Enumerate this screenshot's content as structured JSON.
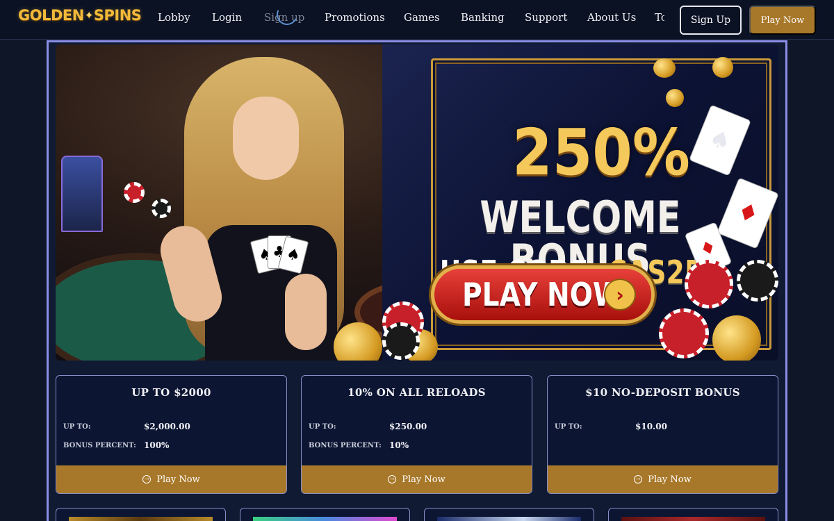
{
  "header": {
    "logo": {
      "left": "GOLDEN",
      "star": "✦",
      "right": "SPINS"
    },
    "nav": [
      {
        "label": "Lobby",
        "state": "normal"
      },
      {
        "label": "Login",
        "state": "normal"
      },
      {
        "label": "Sign up",
        "state": "loading"
      },
      {
        "label": "Promotions",
        "state": "normal"
      },
      {
        "label": "Games",
        "state": "normal"
      },
      {
        "label": "Banking",
        "state": "normal"
      },
      {
        "label": "Support",
        "state": "normal"
      },
      {
        "label": "About Us",
        "state": "normal"
      },
      {
        "label": "To",
        "state": "clipped"
      }
    ],
    "sign_up_button": "Sign Up",
    "play_now_button": "Play Now"
  },
  "hero": {
    "percent": "250%",
    "headline": "WELCOME BONUS",
    "code_prefix": "USE CODE: ",
    "code": "CAS250",
    "cta": "PLAY NOW",
    "cta_arrow": "›",
    "hand_cards": [
      "♠",
      "♣",
      "♠"
    ],
    "side_cards": [
      "♠",
      "♦",
      "♦"
    ]
  },
  "promos": [
    {
      "title": "UP TO $2000",
      "rows": [
        {
          "label": "UP TO:",
          "value": "$2,000.00"
        },
        {
          "label": "BONUS PERCENT:",
          "value": "100%"
        }
      ],
      "cta": "Play Now"
    },
    {
      "title": "10% ON ALL RELOADS",
      "rows": [
        {
          "label": "UP TO:",
          "value": "$250.00"
        },
        {
          "label": "BONUS PERCENT:",
          "value": "10%"
        }
      ],
      "cta": "Play Now"
    },
    {
      "title": "$10 NO-DEPOSIT BONUS",
      "rows": [
        {
          "label": "UP TO:",
          "value": "$10.00"
        }
      ],
      "cta": "Play Now"
    }
  ],
  "colors": {
    "background": "#0f1628",
    "gold": "#a8782a",
    "frame_border": "#8a8ee8",
    "logo_gold": "#f2b93a"
  }
}
